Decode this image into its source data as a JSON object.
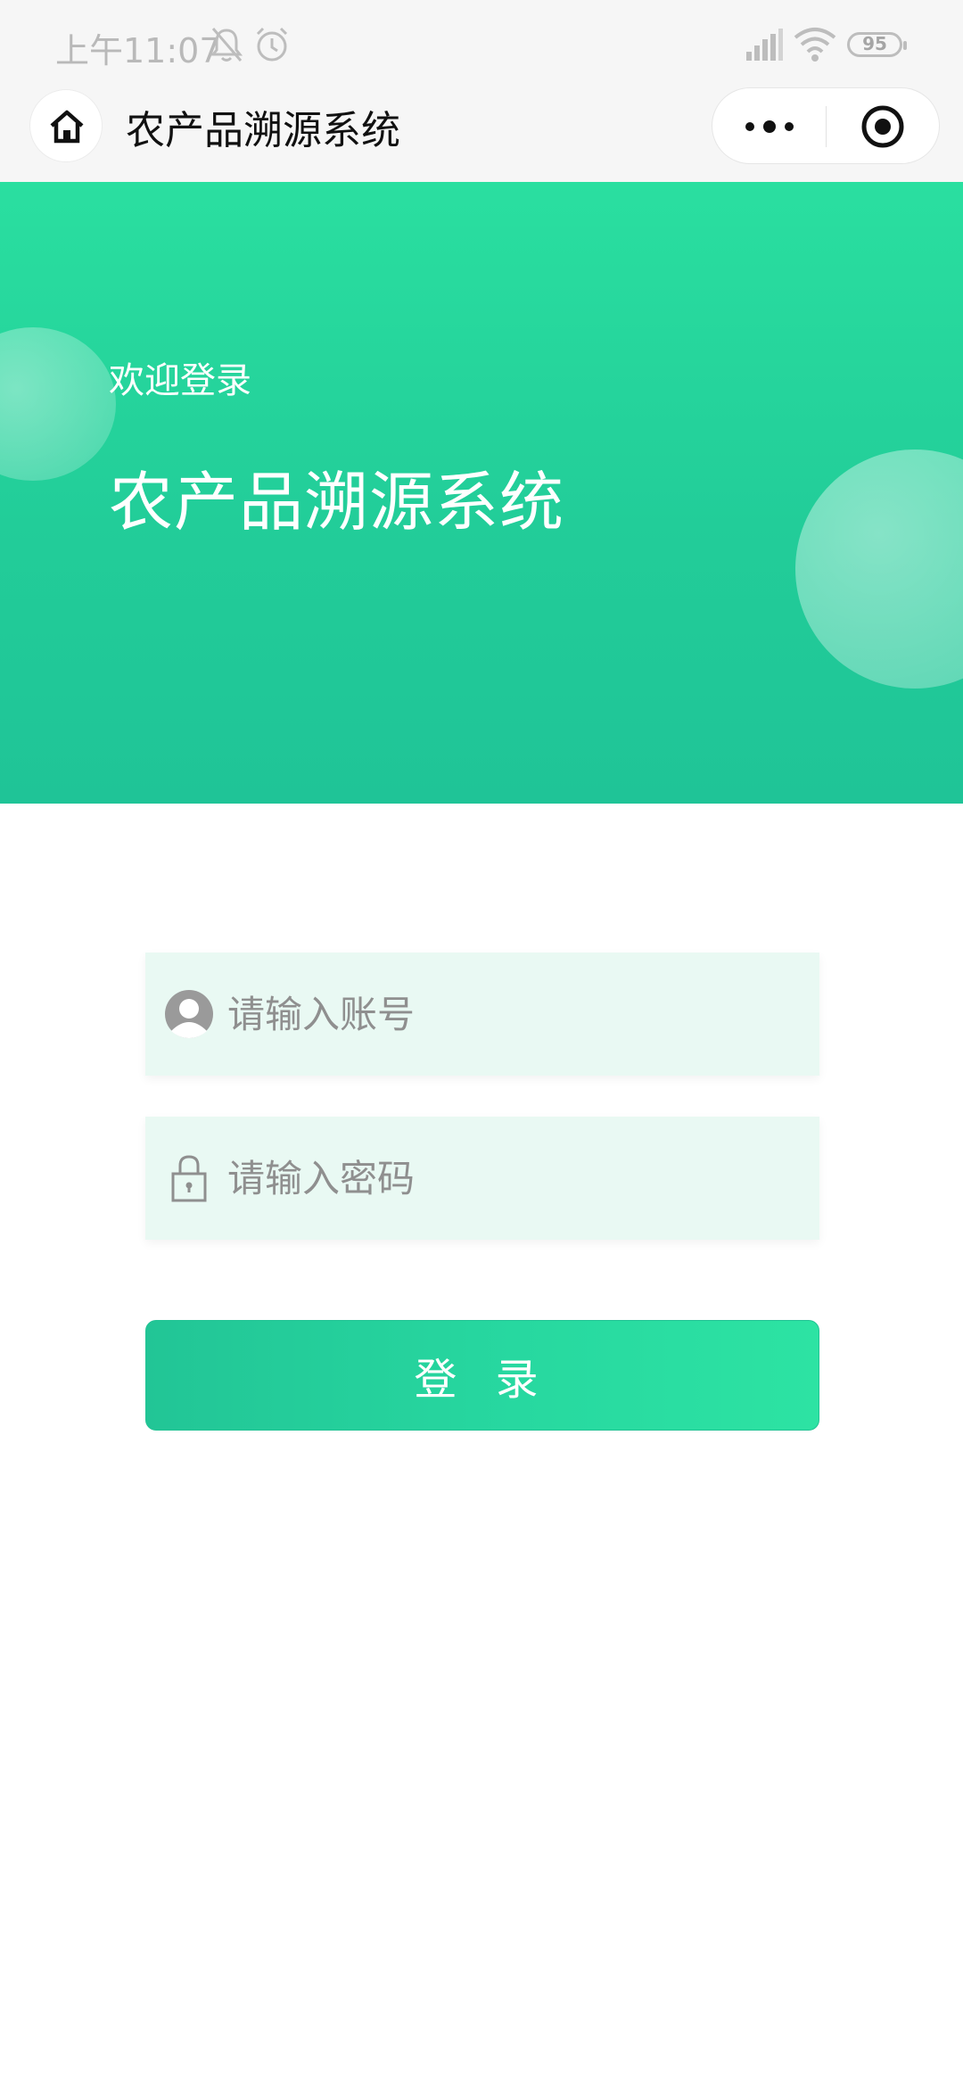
{
  "status_bar": {
    "time": "上午11:07",
    "battery": "95",
    "icons": [
      "bell-muted-icon",
      "alarm-icon",
      "signal-icon",
      "wifi-icon",
      "battery-icon"
    ]
  },
  "nav": {
    "title": "农产品溯源系统",
    "icons": [
      "home-icon",
      "more-icon",
      "close-icon"
    ]
  },
  "hero": {
    "welcome": "欢迎登录",
    "title": "农产品溯源系统"
  },
  "form": {
    "account_placeholder": "请输入账号",
    "password_placeholder": "请输入密码",
    "login_label": "登 录",
    "icons": [
      "user-avatar-icon",
      "lock-icon"
    ]
  },
  "colors": {
    "accent": "#22CD99",
    "accent_light": "#2ADFA0",
    "field_background": "#E9F9F3"
  }
}
